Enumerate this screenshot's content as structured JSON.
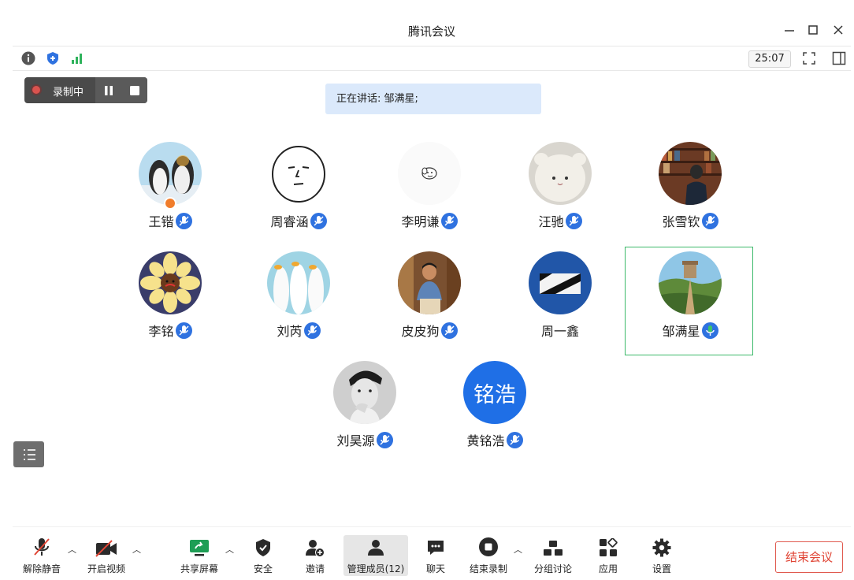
{
  "window": {
    "title": "腾讯会议"
  },
  "infobar": {
    "timer": "25:07"
  },
  "recording": {
    "label": "录制中"
  },
  "speaking": {
    "text": "正在讲话: 邹满星;"
  },
  "participants": [
    {
      "name": "王锴",
      "avatar": "penguins"
    },
    {
      "name": "周睿涵",
      "avatar": "face-sketch"
    },
    {
      "name": "李明谦",
      "avatar": "dog-sketch"
    },
    {
      "name": "汪驰",
      "avatar": "plush-bear"
    },
    {
      "name": "张雪钦",
      "avatar": "library-man"
    },
    {
      "name": "李铭",
      "avatar": "sunflower"
    },
    {
      "name": "刘芮",
      "avatar": "ducks"
    },
    {
      "name": "皮皮狗",
      "avatar": "man-sitting"
    },
    {
      "name": "周一鑫",
      "avatar": "blue-diagonal"
    },
    {
      "name": "邹满星",
      "avatar": "great-wall",
      "speaking": true
    },
    {
      "name": "刘昊源",
      "avatar": "bw-portrait"
    },
    {
      "name": "黄铭浩",
      "avatar": "text-avatar",
      "avatar_text": "铭浩"
    }
  ],
  "toolbar": {
    "unmute": "解除静音",
    "video": "开启视频",
    "share": "共享屏幕",
    "security": "安全",
    "invite": "邀请",
    "members": "管理成员(12)",
    "chat": "聊天",
    "end_recording": "结束录制",
    "breakout": "分组讨论",
    "apps": "应用",
    "settings": "设置",
    "end_meeting": "结束会议"
  },
  "colors": {
    "accent": "#2f72e0",
    "speaking_border": "#3cb96a",
    "end_red": "#e04535",
    "speaking_bg": "#dbe9fb"
  }
}
